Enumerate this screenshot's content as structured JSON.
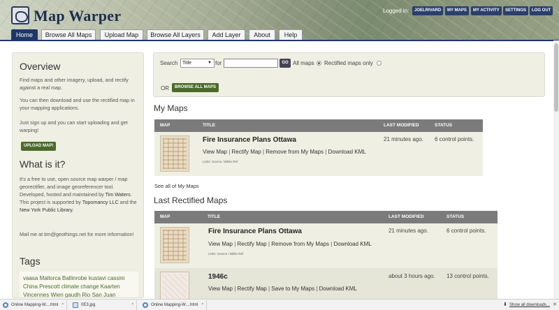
{
  "header": {
    "site_title": "Map Warper",
    "logged_in_label": "Logged in:",
    "user_buttons": [
      "JOELRIVARD",
      "MY MAPS",
      "MY ACTIVITY",
      "SETTINGS",
      "LOG OUT"
    ]
  },
  "nav": {
    "tabs": [
      "Home",
      "Browse All Maps",
      "Upload Map",
      "Browse All Layers",
      "Add Layer",
      "About",
      "Help"
    ],
    "active_tab": "Home"
  },
  "sidebar": {
    "overview_heading": "Overview",
    "overview_p1": "Find maps and other imagery, upload, and rectify against a real map.",
    "overview_p2": "You can then download and use the rectified map in your mapping applications.",
    "overview_p3": "Just sign up and you can start uploading and get warping!",
    "upload_button": "UPLOAD MAP!",
    "what_heading": "What is it?",
    "what_p1_a": "It's a free to use, open source map warper / map georectifier, and image georeferencer tool. Developed, hosted and maintained by",
    "what_p1_b": "Tim Waters",
    "what_p1_c": ". This project is supported by",
    "what_p1_d": "Topomancy LLC",
    "what_p1_e": "and the",
    "what_p1_f": "New York Public Library",
    "what_p1_g": ".",
    "mail_text": "Mail me at tim@geothings.net for more information!",
    "tags_heading": "Tags",
    "tags_text": "vaasa Mallorca Ballinrobe kustavi cassini China Prescott climate change Kaarten Vincennes Wien gaudh Rio San Juan"
  },
  "search": {
    "label": "Search",
    "select_value": "Title",
    "for_label": "for",
    "input_value": "",
    "go_label": "GO",
    "all_maps_label": "All maps",
    "rectified_only_label": "Rectified maps only",
    "or_label": "OR",
    "browse_all_button": "BROWSE ALL MAPS"
  },
  "my_maps": {
    "heading": "My Maps",
    "columns": [
      "MAP",
      "TITLE",
      "LAST MODIFIED",
      "STATUS"
    ],
    "rows": [
      {
        "title": "Fire Insurance Plans Ottawa",
        "actions": [
          "View Map",
          "Rectify Map",
          "Remove from My Maps",
          "Download KML"
        ],
        "links": "Links: Source / Biblio Ref",
        "last_modified": "21 minutes ago.",
        "status": "6 control points."
      }
    ],
    "see_all": "See all of My Maps"
  },
  "last_rectified": {
    "heading": "Last Rectified Maps",
    "columns": [
      "MAP",
      "TITLE",
      "LAST MODIFIED",
      "STATUS"
    ],
    "rows": [
      {
        "title": "Fire Insurance Plans Ottawa",
        "actions": [
          "View Map",
          "Rectify Map",
          "Remove from My Maps",
          "Download KML"
        ],
        "links": "Links: Source / Biblio Ref",
        "last_modified": "21 minutes ago.",
        "status": "6 control points."
      },
      {
        "title": "1946c",
        "actions": [
          "View Map",
          "Rectify Map",
          "Save to My Maps",
          "Download KML"
        ],
        "links": "",
        "last_modified": "about 3 hours ago.",
        "status": "13 control points."
      }
    ]
  },
  "downloads": {
    "items": [
      "Online Mapping-W....html",
      "0E3.jpg",
      "Online Mapping-W....html"
    ],
    "show_all": "Show all downloads..."
  }
}
